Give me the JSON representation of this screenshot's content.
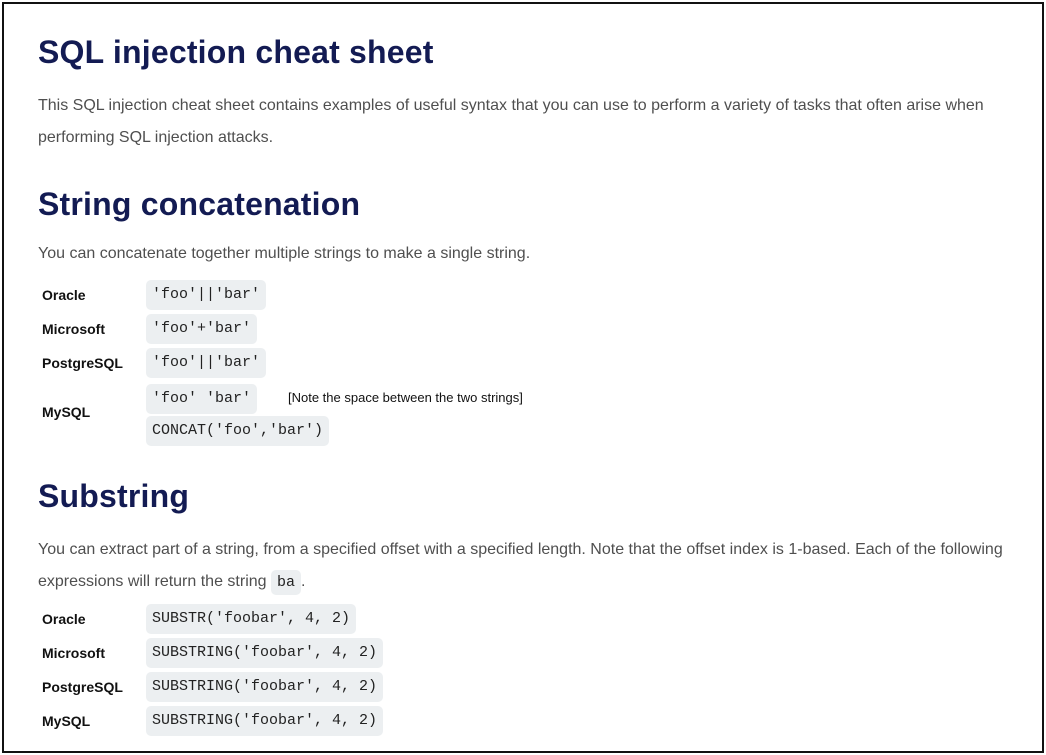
{
  "title": "SQL injection cheat sheet",
  "intro": "This SQL injection cheat sheet contains examples of useful syntax that you can use to perform a variety of tasks that often arise when performing SQL injection attacks.",
  "concat": {
    "heading": "String concatenation",
    "description": "You can concatenate together multiple strings to make a single string.",
    "rows": [
      {
        "db": "Oracle",
        "code": "'foo'||'bar'"
      },
      {
        "db": "Microsoft",
        "code": "'foo'+'bar'"
      },
      {
        "db": "PostgreSQL",
        "code": "'foo'||'bar'"
      },
      {
        "db": "MySQL",
        "code": "'foo' 'bar'",
        "note": "[Note the space between the two strings]",
        "code2": "CONCAT('foo','bar')"
      }
    ]
  },
  "substring": {
    "heading": "Substring",
    "description_part1": "You can extract part of a string, from a specified offset with a specified length. Note that the offset index is 1-based. Each of the following expressions will return the string ",
    "inline_code": "ba",
    "description_part2": ".",
    "rows": [
      {
        "db": "Oracle",
        "code": "SUBSTR('foobar', 4, 2)"
      },
      {
        "db": "Microsoft",
        "code": "SUBSTRING('foobar', 4, 2)"
      },
      {
        "db": "PostgreSQL",
        "code": "SUBSTRING('foobar', 4, 2)"
      },
      {
        "db": "MySQL",
        "code": "SUBSTRING('foobar', 4, 2)"
      }
    ]
  },
  "colors": {
    "heading": "#131b53",
    "body_text": "#4f4f4f",
    "code_background": "#eceff1",
    "frame_border": "#111111"
  }
}
